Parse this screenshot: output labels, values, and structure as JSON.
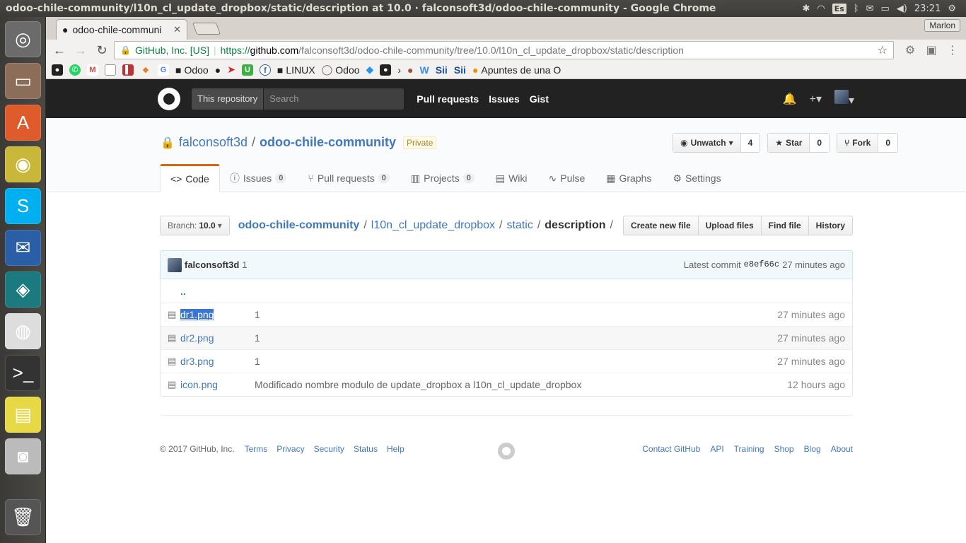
{
  "os": {
    "window_title": "odoo-chile-community/l10n_cl_update_dropbox/static/description at 10.0 · falconsoft3d/odoo-chile-community - Google Chrome",
    "keyboard_layout": "Es",
    "clock": "23:21",
    "launcher": [
      {
        "name": "ubuntu-dash",
        "color": "#6b6b6b",
        "glyph": "◎"
      },
      {
        "name": "file-manager",
        "color": "#8c6d5a",
        "glyph": "▭"
      },
      {
        "name": "software-center",
        "color": "#e05b2b",
        "glyph": "A"
      },
      {
        "name": "rhythmbox",
        "color": "#c9b73a",
        "glyph": "◉"
      },
      {
        "name": "skype",
        "color": "#00aff0",
        "glyph": "S"
      },
      {
        "name": "thunderbird",
        "color": "#2a5fa5",
        "glyph": "✉"
      },
      {
        "name": "gitkraken",
        "color": "#1b7a80",
        "glyph": "◈"
      },
      {
        "name": "chrome",
        "color": "#dddddd",
        "glyph": "◍"
      },
      {
        "name": "terminal",
        "color": "#333333",
        "glyph": ">_"
      },
      {
        "name": "notes",
        "color": "#e7d845",
        "glyph": "▤"
      },
      {
        "name": "camera",
        "color": "#bbbbbb",
        "glyph": "◙"
      }
    ],
    "trash_glyph": "🗑"
  },
  "browser": {
    "tab_title": "odoo-chile-communi",
    "profile": "Marlon",
    "omnibox": {
      "ev_name": "GitHub, Inc. [US]",
      "scheme": "https://",
      "host": "github.com",
      "path": "/falconsoft3d/odoo-chile-community/tree/10.0/l10n_cl_update_dropbox/static/description"
    },
    "bookmarks": {
      "odoo_folder": "Odoo",
      "linux_folder": "LINUX",
      "odoo_link": "Odoo",
      "w": "W",
      "sii1": "Sii",
      "sii2": "Sii",
      "apuntes": "Apuntes de una O"
    }
  },
  "github": {
    "search_scope": "This repository",
    "search_placeholder": "Search",
    "nav": {
      "pull_requests": "Pull requests",
      "issues": "Issues",
      "gist": "Gist"
    },
    "repo": {
      "owner": "falconsoft3d",
      "name": "odoo-chile-community",
      "private_label": "Private",
      "unwatch_label": "Unwatch",
      "watch_count": "4",
      "star_label": "Star",
      "star_count": "0",
      "fork_label": "Fork",
      "fork_count": "0"
    },
    "tabs": {
      "code": "Code",
      "issues": "Issues",
      "issues_count": "0",
      "pulls": "Pull requests",
      "pulls_count": "0",
      "projects": "Projects",
      "projects_count": "0",
      "wiki": "Wiki",
      "pulse": "Pulse",
      "graphs": "Graphs",
      "settings": "Settings"
    },
    "branch": {
      "label": "Branch:",
      "value": "10.0"
    },
    "breadcrumb": {
      "root": "odoo-chile-community",
      "seg1": "l10n_cl_update_dropbox",
      "seg2": "static",
      "final": "description"
    },
    "file_actions": {
      "create": "Create new file",
      "upload": "Upload files",
      "find": "Find file",
      "history": "History"
    },
    "commit": {
      "author": "falconsoft3d",
      "message": "1",
      "latest_label": "Latest commit",
      "sha": "e8ef66c",
      "age": "27 minutes ago"
    },
    "up_dir": "..",
    "files": [
      {
        "name": "dr1.png",
        "message": "1",
        "age": "27 minutes ago"
      },
      {
        "name": "dr2.png",
        "message": "1",
        "age": "27 minutes ago"
      },
      {
        "name": "dr3.png",
        "message": "1",
        "age": "27 minutes ago"
      },
      {
        "name": "icon.png",
        "message": "Modificado nombre modulo de update_dropbox a l10n_cl_update_dropbox",
        "age": "12 hours ago"
      }
    ],
    "footer": {
      "copyright": "© 2017 GitHub, Inc.",
      "left": [
        "Terms",
        "Privacy",
        "Security",
        "Status",
        "Help"
      ],
      "right": [
        "Contact GitHub",
        "API",
        "Training",
        "Shop",
        "Blog",
        "About"
      ]
    }
  }
}
